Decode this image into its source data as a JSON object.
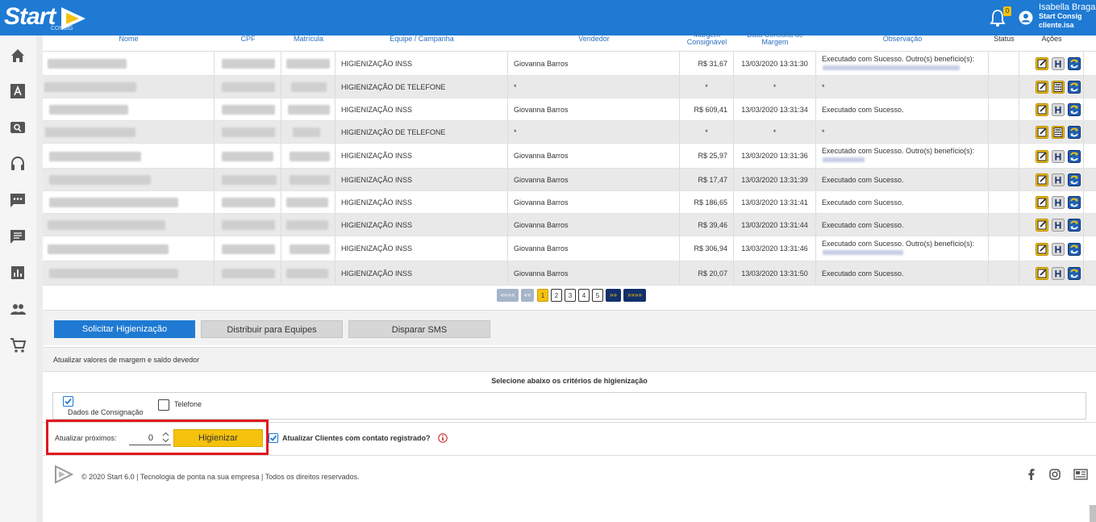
{
  "app": {
    "logo_text": "Start",
    "logo_sub": "CONSIG",
    "notifications_count": "0",
    "user_name": "Isabella Braga",
    "user_company": "Start Consig",
    "user_login": "cliente.isa"
  },
  "sidebar": {
    "items": [
      {
        "icon": "home-icon"
      },
      {
        "icon": "font-icon"
      },
      {
        "icon": "search-icon"
      },
      {
        "icon": "headset-icon"
      },
      {
        "icon": "chat-dots-icon"
      },
      {
        "icon": "message-icon"
      },
      {
        "icon": "bar-chart-icon"
      },
      {
        "icon": "people-icon"
      },
      {
        "icon": "cart-icon"
      }
    ]
  },
  "table": {
    "headers": {
      "nome": "Nome",
      "cpf": "CPF",
      "matricula": "Matrícula",
      "equipe": "Equipe / Campanha",
      "vendedor": "Vendedor",
      "margem": "Margem Consignável",
      "data": "Data Consulta de Margem",
      "observacao": "Observação",
      "status": "Status",
      "acoes": "Ações"
    },
    "rows": [
      {
        "equipe": "HIGIENIZAÇÃO INSS",
        "vendedor": "Giovanna Barros",
        "margem": "R$ 31,67",
        "data": "13/03/2020 13:31:30",
        "obs": "Executado com Sucesso. Outro(s) benefício(s):",
        "status": ""
      },
      {
        "equipe": "HIGIENIZAÇÃO DE TELEFONE",
        "vendedor": "*",
        "margem": "*",
        "data": "*",
        "obs": "*",
        "status": ""
      },
      {
        "equipe": "HIGIENIZAÇÃO INSS",
        "vendedor": "Giovanna Barros",
        "margem": "R$ 609,41",
        "data": "13/03/2020 13:31:34",
        "obs": "Executado com Sucesso.",
        "status": ""
      },
      {
        "equipe": "HIGIENIZAÇÃO DE TELEFONE",
        "vendedor": "*",
        "margem": "*",
        "data": "*",
        "obs": "*",
        "status": ""
      },
      {
        "equipe": "HIGIENIZAÇÃO INSS",
        "vendedor": "Giovanna Barros",
        "margem": "R$ 25,97",
        "data": "13/03/2020 13:31:36",
        "obs": "Executado com Sucesso. Outro(s) benefício(s):",
        "status": ""
      },
      {
        "equipe": "HIGIENIZAÇÃO INSS",
        "vendedor": "Giovanna Barros",
        "margem": "R$ 17,47",
        "data": "13/03/2020 13:31:39",
        "obs": "Executado com Sucesso.",
        "status": ""
      },
      {
        "equipe": "HIGIENIZAÇÃO INSS",
        "vendedor": "Giovanna Barros",
        "margem": "R$ 186,65",
        "data": "13/03/2020 13:31:41",
        "obs": "Executado com Sucesso.",
        "status": ""
      },
      {
        "equipe": "HIGIENIZAÇÃO INSS",
        "vendedor": "Giovanna Barros",
        "margem": "R$ 39,46",
        "data": "13/03/2020 13:31:44",
        "obs": "Executado com Sucesso.",
        "status": ""
      },
      {
        "equipe": "HIGIENIZAÇÃO INSS",
        "vendedor": "Giovanna Barros",
        "margem": "R$ 306,94",
        "data": "13/03/2020 13:31:46",
        "obs": "Executado com Sucesso. Outro(s) benefício(s):",
        "status": ""
      },
      {
        "equipe": "HIGIENIZAÇÃO INSS",
        "vendedor": "Giovanna Barros",
        "margem": "R$ 20,07",
        "data": "13/03/2020 13:31:50",
        "obs": "Executado com Sucesso.",
        "status": ""
      }
    ]
  },
  "pagination": {
    "first": "««««",
    "prev": "««",
    "pages": [
      "1",
      "2",
      "3",
      "4",
      "5"
    ],
    "current": "1",
    "next": "»»",
    "last": "»»»»"
  },
  "actions": {
    "solicitar": "Solicitar Higienização",
    "distribuir": "Distribuir para Equipes",
    "disparar": "Disparar SMS"
  },
  "higienizacao": {
    "update_title": "Atualizar valores de margem e saldo devedor",
    "criteria_title": "Selecione abaixo os critérios de higienização",
    "opt_consignacao": "Dados de Consignação",
    "opt_consignacao_checked": true,
    "opt_telefone": "Telefone",
    "opt_telefone_checked": false,
    "proximos_label": "Atualizar próximos:",
    "proximos_value": "0",
    "button": "Higienizar",
    "atualizar_clientes": "Atualizar Clientes com contato registrado?",
    "atualizar_clientes_checked": true
  },
  "footer": {
    "text": "© 2020 Start 6.0 | Tecnologia de ponta na sua empresa | Todos os direitos reservados."
  },
  "colors": {
    "header_blue": "#1e7ad3",
    "accent_yellow": "#f4c20d",
    "highlight_red": "#e0191f"
  }
}
